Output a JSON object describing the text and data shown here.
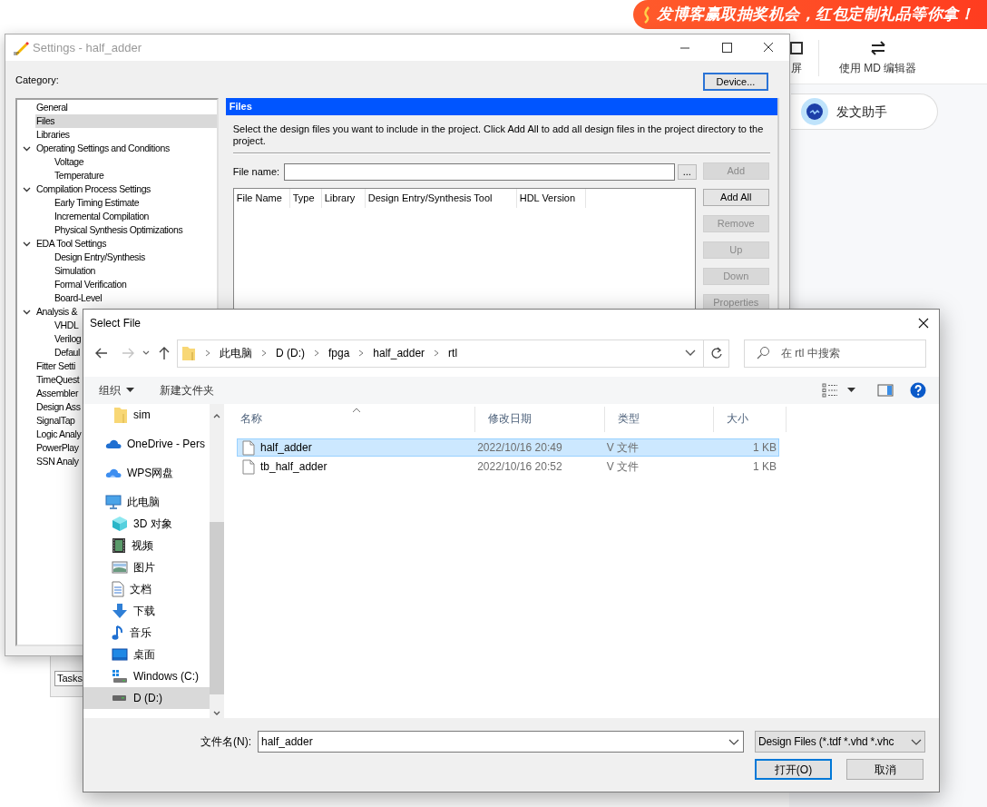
{
  "background_page": {
    "banner": "发博客赢取抽奖机会，红包定制礼品等你拿！",
    "toolbar": [
      {
        "label": "屏",
        "kind": "screen"
      },
      {
        "label": "使用 MD 编辑器",
        "kind": "swap"
      }
    ],
    "assistant_button": "发文助手",
    "tasks_tab": "Tasks"
  },
  "settings_window": {
    "title": "Settings - half_adder",
    "category_label": "Category:",
    "device_button": "Device...",
    "categories": [
      {
        "label": "General",
        "selected": false
      },
      {
        "label": "Files",
        "selected": true
      },
      {
        "label": "Libraries",
        "selected": false
      },
      {
        "label": "Operating Settings and Conditions",
        "selected": false,
        "expanded": true,
        "children": [
          {
            "label": "Voltage",
            "selected": false
          },
          {
            "label": "Temperature",
            "selected": false
          }
        ]
      },
      {
        "label": "Compilation Process Settings",
        "selected": false,
        "expanded": true,
        "children": [
          {
            "label": "Early Timing Estimate",
            "selected": false
          },
          {
            "label": "Incremental Compilation",
            "selected": false
          },
          {
            "label": "Physical Synthesis Optimizations",
            "selected": false
          }
        ]
      },
      {
        "label": "EDA Tool Settings",
        "selected": false,
        "expanded": true,
        "children": [
          {
            "label": "Design Entry/Synthesis",
            "selected": false
          },
          {
            "label": "Simulation",
            "selected": false
          },
          {
            "label": "Formal Verification",
            "selected": false
          },
          {
            "label": "Board-Level",
            "selected": false
          }
        ]
      },
      {
        "label": "Analysis &",
        "selected": false,
        "expanded": true,
        "children": [
          {
            "label": "VHDL",
            "selected": false
          },
          {
            "label": "Verilog",
            "selected": false
          },
          {
            "label": "Defaul",
            "selected": false
          }
        ]
      },
      {
        "label": "Fitter Setti",
        "selected": false
      },
      {
        "label": "TimeQuest",
        "selected": false
      },
      {
        "label": "Assembler",
        "selected": false
      },
      {
        "label": "Design Ass",
        "selected": false
      },
      {
        "label": "SignalTap",
        "selected": false
      },
      {
        "label": "Logic Analy",
        "selected": false
      },
      {
        "label": "PowerPlay",
        "selected": false
      },
      {
        "label": "SSN Analy",
        "selected": false
      }
    ],
    "panel": {
      "title": "Files",
      "description": "Select the design files you want to include in the project. Click Add All to add all design files in the project directory to the project.",
      "file_name_label": "File name:",
      "browse_button": "...",
      "table_columns": [
        "File Name",
        "Type",
        "Library",
        "Design Entry/Synthesis Tool",
        "HDL Version"
      ],
      "buttons": [
        {
          "label": "Add",
          "disabled": true
        },
        {
          "label": "Add All",
          "disabled": false
        },
        {
          "label": "Remove",
          "disabled": true
        },
        {
          "label": "Up",
          "disabled": true
        },
        {
          "label": "Down",
          "disabled": true
        },
        {
          "label": "Properties",
          "disabled": true
        }
      ]
    }
  },
  "select_file_dialog": {
    "title": "Select File",
    "breadcrumb": [
      "此电脑",
      "D (D:)",
      "fpga",
      "half_adder",
      "rtl"
    ],
    "search_placeholder": "在 rtl 中搜索",
    "toolbar": [
      {
        "label": "组织",
        "dropdown": true
      },
      {
        "label": "新建文件夹",
        "dropdown": false
      }
    ],
    "nav_pane": [
      {
        "label": "sim",
        "kind": "folder",
        "selected": false
      },
      {
        "label": "OneDrive - Pers",
        "kind": "onedrive",
        "selected": false
      },
      {
        "label": "WPS网盘",
        "kind": "wps",
        "selected": false
      },
      {
        "label": "此电脑",
        "kind": "pc",
        "selected": false,
        "children": [
          {
            "label": "3D 对象",
            "kind": "cube",
            "selected": false
          },
          {
            "label": "视频",
            "kind": "video",
            "selected": false
          },
          {
            "label": "图片",
            "kind": "pictures",
            "selected": false
          },
          {
            "label": "文档",
            "kind": "documents",
            "selected": false
          },
          {
            "label": "下载",
            "kind": "downloads",
            "selected": false
          },
          {
            "label": "音乐",
            "kind": "music",
            "selected": false
          },
          {
            "label": "桌面",
            "kind": "desktop",
            "selected": false
          },
          {
            "label": "Windows (C:)",
            "kind": "windows_drive",
            "selected": false
          },
          {
            "label": "D (D:)",
            "kind": "drive",
            "selected": true
          }
        ]
      }
    ],
    "columns": [
      "名称",
      "修改日期",
      "类型",
      "大小"
    ],
    "files": [
      {
        "name": "half_adder",
        "modified": "2022/10/16 20:49",
        "type": "V 文件",
        "size": "1 KB",
        "selected": true
      },
      {
        "name": "tb_half_adder",
        "modified": "2022/10/16 20:52",
        "type": "V 文件",
        "size": "1 KB",
        "selected": false
      }
    ],
    "file_name_label": "文件名(N):",
    "file_name_value": "half_adder",
    "filter": "Design Files (*.tdf *.vhd *.vhc",
    "open_button": "打开(O)",
    "cancel_button": "取消"
  }
}
